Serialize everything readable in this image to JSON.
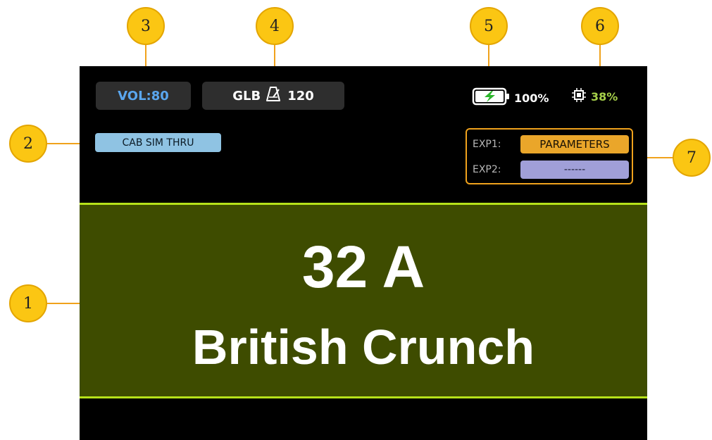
{
  "status_bar": {
    "volume": "VOL:80",
    "tempo_mode": "GLB",
    "tempo_value": "120",
    "battery": "100%",
    "cpu": "38%"
  },
  "cab_sim": "CAB SIM THRU",
  "expression": {
    "exp1_label": "EXP1:",
    "exp1_value": "PARAMETERS",
    "exp2_label": "EXP2:",
    "exp2_value": "------"
  },
  "preset": {
    "number": "32 A",
    "name": "British Crunch"
  },
  "callouts": [
    "1",
    "2",
    "3",
    "4",
    "5",
    "6",
    "7"
  ],
  "icons": {
    "battery": "battery-charging-icon",
    "cpu": "cpu-chip-icon",
    "metronome": "metronome-icon"
  },
  "colors": {
    "accent_callout": "#fbc613",
    "panel_bg": "#3e4c00",
    "panel_border": "#b6e21a",
    "volume_text": "#5aa6ee",
    "cpu_text": "#a6d04a"
  }
}
